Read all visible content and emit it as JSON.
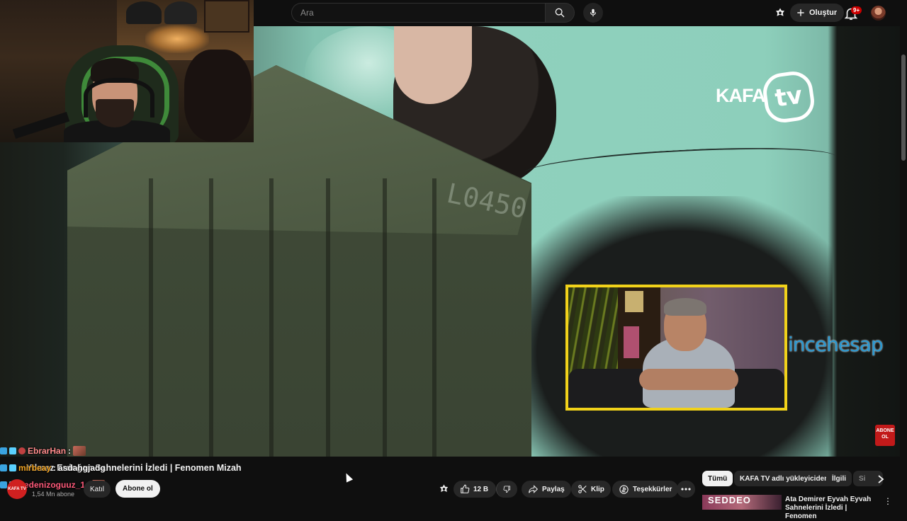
{
  "search": {
    "placeholder": "Ara"
  },
  "header": {
    "create_label": "Oluştur",
    "notif_count": "9+"
  },
  "video": {
    "logo_text": "KAFA",
    "logo_tv": "tv",
    "watermark": "incehesap",
    "abone_badge": "ABONE OL",
    "title": "Yılmaz Erdoğan Sahnelerini İzledi | Fenomen Mizah"
  },
  "chat": [
    {
      "user": "EbrarHan",
      "sep": " :",
      "message": "",
      "color": "#ff8c8c"
    },
    {
      "user": "mirbeay",
      "sep": " :",
      "message": "asdahgjadg",
      "color": "#f5a623"
    },
    {
      "user": "Sedenizoguuz_1",
      "sep": " :",
      "message": "",
      "color": "#ff5a7a"
    }
  ],
  "channel": {
    "avatar_text": "KAFA TV",
    "subscribers": "1,54 Mn abone",
    "join_label": "Katıl",
    "subscribe_label": "Abone ol"
  },
  "actions": {
    "likes": "12 B",
    "share": "Paylaş",
    "clip": "Klip",
    "thanks": "Teşekkürler"
  },
  "chips": [
    "Tümü",
    "KAFA TV adlı yükleyiciden",
    "İlgili",
    "Si"
  ],
  "recommendation": {
    "thumb_text": "SEDDEO",
    "title": "Ata Demirer Eyvah Eyvah Sahnelerini İzledi | Fenomen"
  },
  "colors": {
    "background": "#0f0f0f",
    "inset_border": "#f1d21a",
    "watermark": "#2a98d0",
    "accent_red": "#cc0000"
  }
}
